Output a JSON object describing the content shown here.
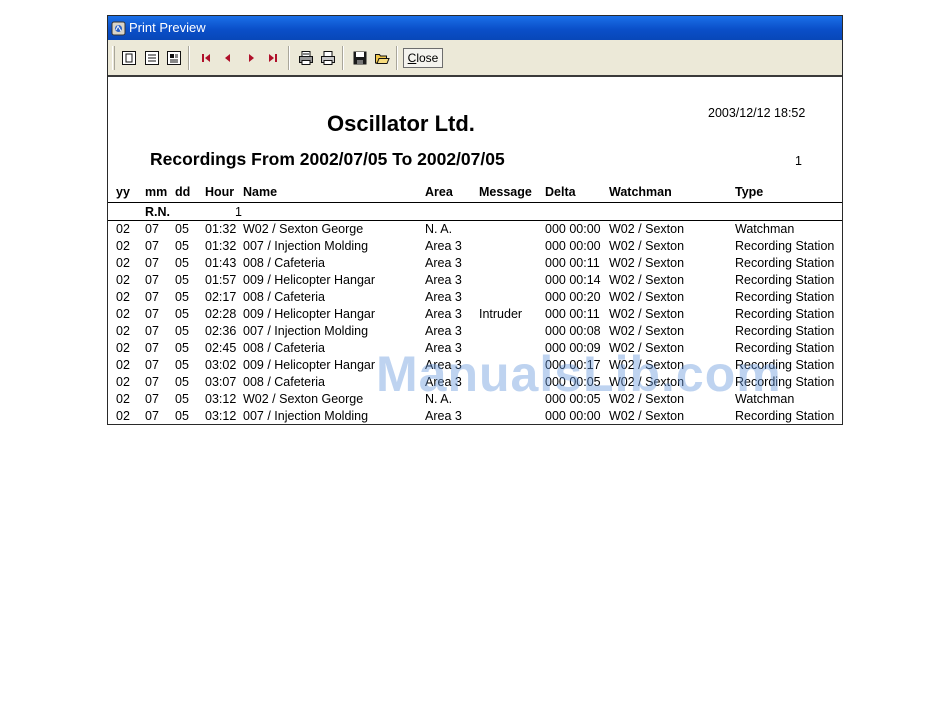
{
  "window": {
    "title": "Print Preview"
  },
  "toolbar": {
    "icons": [
      "one-page-view-icon",
      "two-page-view-icon",
      "zoom-fit-icon",
      "first-page-icon",
      "previous-page-icon",
      "next-page-icon",
      "last-page-icon",
      "printer-setup-icon",
      "print-icon",
      "save-icon",
      "open-icon"
    ],
    "close_label_u": "C",
    "close_label_rest": "lose"
  },
  "report": {
    "company": "Oscillator Ltd.",
    "datetime": "2003/12/12 18:52",
    "subtitle": "Recordings From 2002/07/05 To 2002/07/05",
    "page_number": "1",
    "columns": {
      "yy": "yy",
      "mm": "mm",
      "dd": "dd",
      "hour": "Hour",
      "name": "Name",
      "area": "Area",
      "message": "Message",
      "delta": "Delta",
      "watchman": "Watchman",
      "type": "Type"
    },
    "rn_label": "R.N.",
    "rn_value": "1",
    "rows": [
      {
        "yy": "02",
        "mm": "07",
        "dd": "05",
        "hour": "01:32",
        "name": "W02 / Sexton George",
        "area": "N. A.",
        "message": "",
        "delta": "000 00:00",
        "watchman": "W02 / Sexton",
        "type": "Watchman"
      },
      {
        "yy": "02",
        "mm": "07",
        "dd": "05",
        "hour": "01:32",
        "name": "007 / Injection Molding",
        "area": "Area 3",
        "message": "",
        "delta": "000 00:00",
        "watchman": "W02 / Sexton",
        "type": "Recording Station"
      },
      {
        "yy": "02",
        "mm": "07",
        "dd": "05",
        "hour": "01:43",
        "name": "008 / Cafeteria",
        "area": "Area 3",
        "message": "",
        "delta": "000 00:11",
        "watchman": "W02 / Sexton",
        "type": "Recording Station"
      },
      {
        "yy": "02",
        "mm": "07",
        "dd": "05",
        "hour": "01:57",
        "name": "009 / Helicopter Hangar",
        "area": "Area 3",
        "message": "",
        "delta": "000 00:14",
        "watchman": "W02 / Sexton",
        "type": "Recording Station"
      },
      {
        "yy": "02",
        "mm": "07",
        "dd": "05",
        "hour": "02:17",
        "name": "008 / Cafeteria",
        "area": "Area 3",
        "message": "",
        "delta": "000 00:20",
        "watchman": "W02 / Sexton",
        "type": "Recording Station"
      },
      {
        "yy": "02",
        "mm": "07",
        "dd": "05",
        "hour": "02:28",
        "name": "009 / Helicopter Hangar",
        "area": "Area 3",
        "message": "Intruder",
        "delta": "000 00:11",
        "watchman": "W02 / Sexton",
        "type": "Recording Station"
      },
      {
        "yy": "02",
        "mm": "07",
        "dd": "05",
        "hour": "02:36",
        "name": "007 / Injection Molding",
        "area": "Area 3",
        "message": "",
        "delta": "000 00:08",
        "watchman": "W02 / Sexton",
        "type": "Recording Station"
      },
      {
        "yy": "02",
        "mm": "07",
        "dd": "05",
        "hour": "02:45",
        "name": "008 / Cafeteria",
        "area": "Area 3",
        "message": "",
        "delta": "000 00:09",
        "watchman": "W02 / Sexton",
        "type": "Recording Station"
      },
      {
        "yy": "02",
        "mm": "07",
        "dd": "05",
        "hour": "03:02",
        "name": "009 / Helicopter Hangar",
        "area": "Area 3",
        "message": "",
        "delta": "000 00:17",
        "watchman": "W02 / Sexton",
        "type": "Recording Station"
      },
      {
        "yy": "02",
        "mm": "07",
        "dd": "05",
        "hour": "03:07",
        "name": "008 / Cafeteria",
        "area": "Area 3",
        "message": "",
        "delta": "000 00:05",
        "watchman": "W02 / Sexton",
        "type": "Recording Station"
      },
      {
        "yy": "02",
        "mm": "07",
        "dd": "05",
        "hour": "03:12",
        "name": "W02 / Sexton George",
        "area": "N. A.",
        "message": "",
        "delta": "000 00:05",
        "watchman": "W02 / Sexton",
        "type": "Watchman"
      },
      {
        "yy": "02",
        "mm": "07",
        "dd": "05",
        "hour": "03:12",
        "name": "007 / Injection Molding",
        "area": "Area 3",
        "message": "",
        "delta": "000 00:00",
        "watchman": "W02 / Sexton",
        "type": "Recording Station"
      }
    ]
  },
  "watermark": "ManualsLib.com",
  "colors": {
    "titlebar": "#0a4fc9",
    "toolbar": "#ece9d8",
    "icon_red": "#b0102a",
    "icon_dark": "#1a1a1a"
  }
}
